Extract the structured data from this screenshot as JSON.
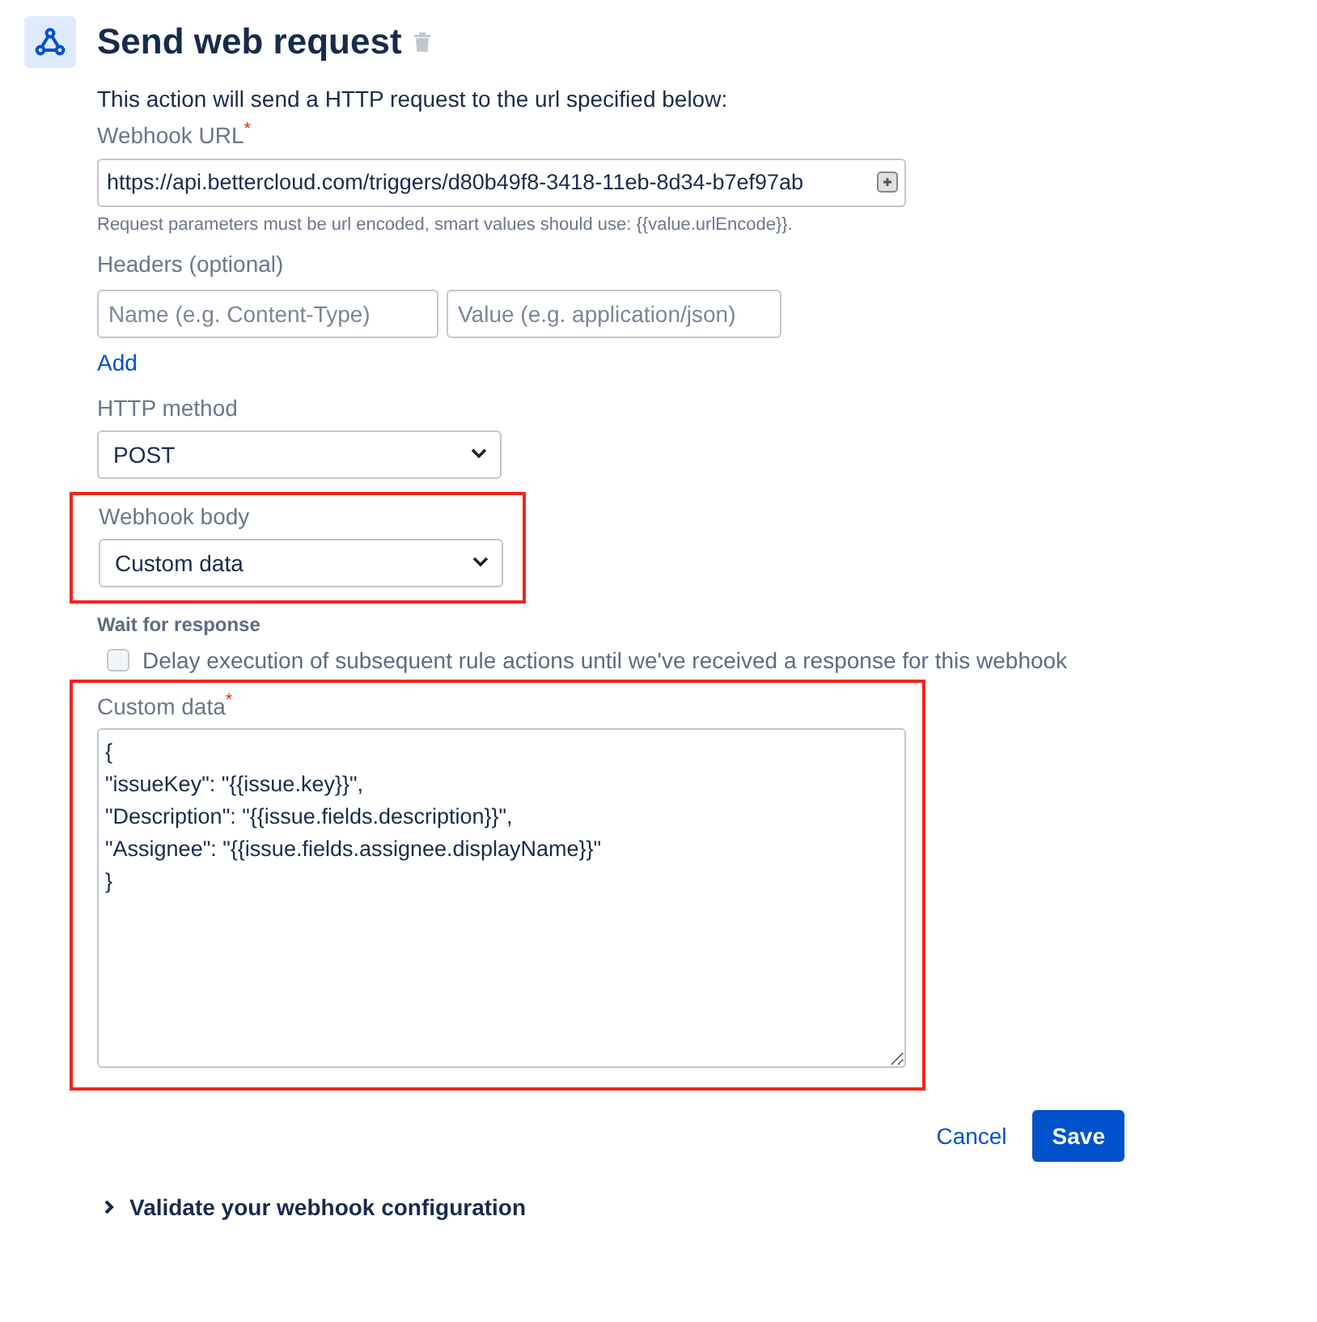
{
  "header": {
    "title": "Send web request"
  },
  "description": "This action will send a HTTP request to the url specified below:",
  "webhook_url": {
    "label": "Webhook URL",
    "required_mark": "*",
    "value": "https://api.bettercloud.com/triggers/d80b49f8-3418-11eb-8d34-b7ef97ab",
    "hint": "Request parameters must be url encoded, smart values should use: {{value.urlEncode}}."
  },
  "headers": {
    "label": "Headers (optional)",
    "name_placeholder": "Name (e.g. Content-Type)",
    "value_placeholder": "Value (e.g. application/json)",
    "add_link": "Add"
  },
  "http_method": {
    "label": "HTTP method",
    "value": "POST"
  },
  "webhook_body": {
    "label": "Webhook body",
    "value": "Custom data",
    "highlighted": true
  },
  "wait_for_response": {
    "heading": "Wait for response",
    "checkbox_label": "Delay execution of subsequent rule actions until we've received a response for this webhook",
    "checked": false
  },
  "custom_data": {
    "label": "Custom data",
    "required_mark": "*",
    "highlighted": true,
    "lines": [
      "{",
      "\"issueKey\": \"{{issue.key}}\",",
      "\"Description\": \"{{issue.fields.description}}\",",
      "\"Assignee\": \"{{issue.fields.assignee.displayName}}\"",
      "}"
    ]
  },
  "buttons": {
    "cancel": "Cancel",
    "save": "Save"
  },
  "validate": {
    "label": "Validate your webhook configuration",
    "expanded": false
  }
}
